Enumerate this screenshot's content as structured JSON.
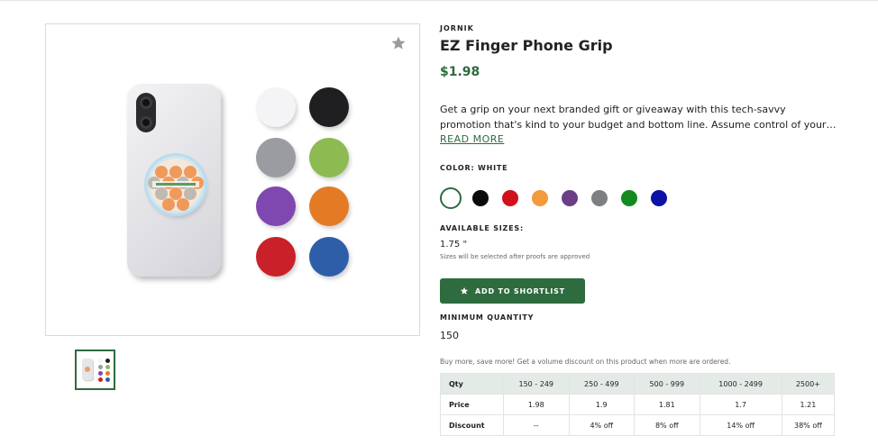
{
  "product": {
    "brand": "JORNIK",
    "title": "EZ Finger Phone Grip",
    "price": "$1.98",
    "description": "Get a grip on your next branded gift or giveaway with this tech-savvy promotion that's kind to your budget and bottom line. Assume control of your cellphone or oth...",
    "read_more": "READ MORE"
  },
  "colors": {
    "label": "COLOR: WHITE",
    "options": [
      {
        "name": "white",
        "hex": "#ffffff",
        "selected": true
      },
      {
        "name": "black",
        "hex": "#0b0b0b"
      },
      {
        "name": "red",
        "hex": "#d0101b"
      },
      {
        "name": "orange",
        "hex": "#f39a3c"
      },
      {
        "name": "purple",
        "hex": "#6a3f86"
      },
      {
        "name": "gray",
        "hex": "#7d8082"
      },
      {
        "name": "green",
        "hex": "#138a1f"
      },
      {
        "name": "blue",
        "hex": "#0c12a8"
      }
    ]
  },
  "sizes": {
    "label": "AVAILABLE SIZES:",
    "value": "1.75 \"",
    "note": "Sizes will be selected after proofs are approved"
  },
  "shortlist_button": "ADD TO SHORTLIST",
  "minimum_quantity": {
    "label": "MINIMUM QUANTITY",
    "value": "150"
  },
  "volume_note": "Buy more, save more! Get a volume discount on this product when more are ordered.",
  "pricing_table": {
    "qty_label": "Qty",
    "price_label": "Price",
    "discount_label": "Discount",
    "tiers": [
      {
        "qty": "150 - 249",
        "price": "1.98",
        "discount": "--"
      },
      {
        "qty": "250 - 499",
        "price": "1.9",
        "discount": "4% off"
      },
      {
        "qty": "500 - 999",
        "price": "1.81",
        "discount": "8% off"
      },
      {
        "qty": "1000 - 2499",
        "price": "1.7",
        "discount": "14% off"
      },
      {
        "qty": "2500+",
        "price": "1.21",
        "discount": "38% off"
      }
    ]
  },
  "image_swatches": [
    "#f4f4f7",
    "#1f1f22",
    "#9a9ca1",
    "#8dbb52",
    "#7f47b0",
    "#e57a24",
    "#c9202a",
    "#2f5ea8"
  ],
  "icons": {
    "favorite": "star-icon",
    "shortlist": "star-icon"
  }
}
